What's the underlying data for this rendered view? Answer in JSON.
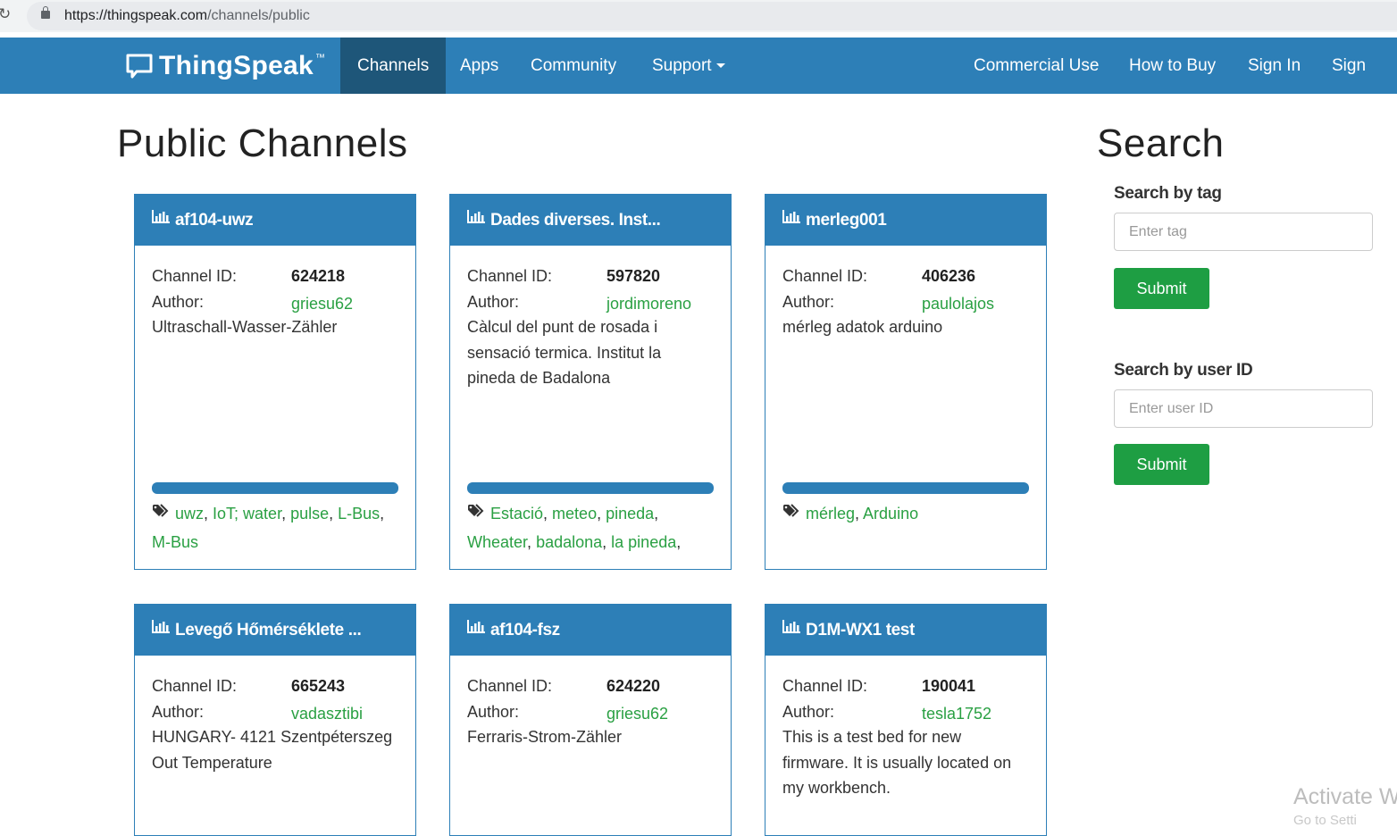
{
  "browser": {
    "url_host": "https://thingspeak.com",
    "url_path": "/channels/public"
  },
  "navbar": {
    "brand": "ThingSpeak",
    "brand_tm": "™",
    "left_items": [
      "Channels",
      "Apps",
      "Community",
      "Support"
    ],
    "right_items": [
      "Commercial Use",
      "How to Buy",
      "Sign In",
      "Sign Up"
    ],
    "active": "Channels"
  },
  "page": {
    "title": "Public Channels"
  },
  "labels": {
    "channel_id": "Channel ID:",
    "author": "Author:"
  },
  "channels": [
    {
      "name": "af104-uwz",
      "id": "624218",
      "author": "griesu62",
      "description": "Ultraschall-Wasser-Zähler",
      "tags": [
        "uwz",
        "IoT; water",
        "pulse",
        "L-Bus",
        "M-Bus"
      ]
    },
    {
      "name": "Dades diverses. Inst...",
      "id": "597820",
      "author": "jordimoreno",
      "description": "Càlcul del punt de rosada i sensació termica. Institut la pineda de Badalona",
      "tags": [
        "Estació",
        "meteo",
        "pineda",
        "Wheater",
        "badalona",
        "la pineda"
      ]
    },
    {
      "name": "merleg001",
      "id": "406236",
      "author": "paulolajos",
      "description": "mérleg adatok arduino",
      "tags": [
        "mérleg",
        "Arduino"
      ]
    },
    {
      "name": "Levegő Hőmérséklete ...",
      "id": "665243",
      "author": "vadasztibi",
      "description": "HUNGARY- 4121 Szentpéterszeg Out Temperature",
      "tags": []
    },
    {
      "name": "af104-fsz",
      "id": "624220",
      "author": "griesu62",
      "description": "Ferraris-Strom-Zähler",
      "tags": []
    },
    {
      "name": "D1M-WX1 test",
      "id": "190041",
      "author": "tesla1752",
      "description": "This is a test bed for new firmware. It is usually located on my workbench.",
      "tags": []
    }
  ],
  "search": {
    "title": "Search",
    "tag_label": "Search by tag",
    "tag_placeholder": "Enter tag",
    "user_label": "Search by user ID",
    "user_placeholder": "Enter user ID",
    "submit": "Submit"
  },
  "watermark": {
    "line1": "Activate W",
    "line2": "Go to Setti"
  },
  "colors": {
    "primary": "#2d7fb7",
    "active_nav": "#1e5679",
    "link_green": "#2aa043",
    "button_green": "#1e9e43"
  }
}
